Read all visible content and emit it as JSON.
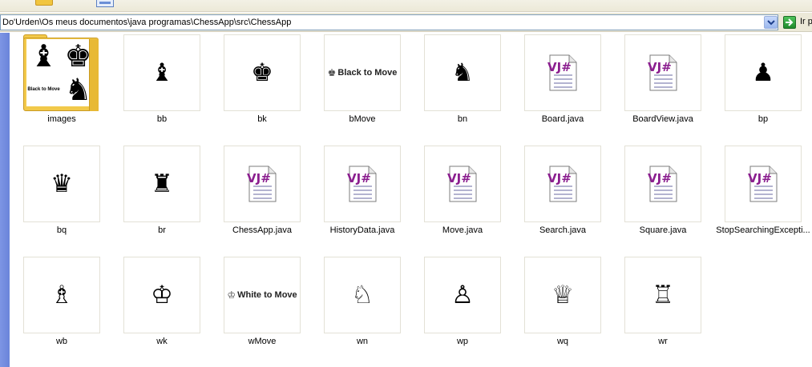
{
  "address": {
    "path": "Do'Urden\\Os meus documentos\\java programas\\ChessApp\\src\\ChessApp",
    "go_label": "Ir p"
  },
  "folder_preview": {
    "move_text": "Black to Move",
    "pieces": [
      "♝",
      "♚",
      "♞"
    ]
  },
  "files": [
    {
      "name": "images",
      "kind": "folder"
    },
    {
      "name": "bb",
      "kind": "piece",
      "glyph": "♝"
    },
    {
      "name": "bk",
      "kind": "piece",
      "glyph": "♚"
    },
    {
      "name": "bMove",
      "kind": "move",
      "glyph": "♚",
      "text": "Black to Move"
    },
    {
      "name": "bn",
      "kind": "piece",
      "glyph": "♞"
    },
    {
      "name": "Board.java",
      "kind": "java"
    },
    {
      "name": "BoardView.java",
      "kind": "java"
    },
    {
      "name": "bp",
      "kind": "piece",
      "glyph": "♟"
    },
    {
      "name": "bq",
      "kind": "piece",
      "glyph": "♛"
    },
    {
      "name": "br",
      "kind": "piece",
      "glyph": "♜"
    },
    {
      "name": "ChessApp.java",
      "kind": "java"
    },
    {
      "name": "HistoryData.java",
      "kind": "java"
    },
    {
      "name": "Move.java",
      "kind": "java"
    },
    {
      "name": "Search.java",
      "kind": "java"
    },
    {
      "name": "Square.java",
      "kind": "java"
    },
    {
      "name": "StopSearchingExcepti...",
      "kind": "java"
    },
    {
      "name": "wb",
      "kind": "piece",
      "glyph": "♗"
    },
    {
      "name": "wk",
      "kind": "piece",
      "glyph": "♔"
    },
    {
      "name": "wMove",
      "kind": "move",
      "glyph": "♔",
      "text": "White to Move"
    },
    {
      "name": "wn",
      "kind": "piece",
      "glyph": "♘"
    },
    {
      "name": "wp",
      "kind": "piece",
      "glyph": "♙"
    },
    {
      "name": "wq",
      "kind": "piece",
      "glyph": "♕"
    },
    {
      "name": "wr",
      "kind": "piece",
      "glyph": "♖"
    }
  ],
  "java_icon": {
    "text": "VJ#",
    "color": "#8b1f8f"
  },
  "colors": {
    "address_border": "#7f9db9",
    "go_green": "#2a9a36",
    "task_pane_blue": "#7d95e4",
    "folder_yellow": "#f2c94a"
  }
}
